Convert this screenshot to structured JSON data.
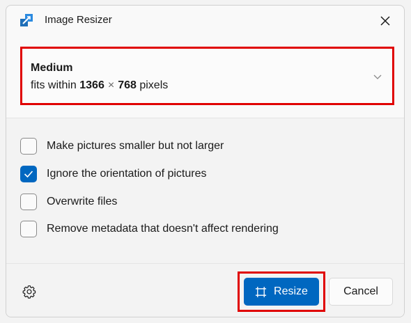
{
  "window": {
    "title": "Image Resizer",
    "app_icon": "image-resizer-app-icon",
    "close_icon": "close-icon"
  },
  "size": {
    "name": "Medium",
    "prefix": "fits within",
    "width": "1366",
    "times": "×",
    "height": "768",
    "unit": "pixels",
    "dropdown_icon": "chevron-down-icon"
  },
  "options": [
    {
      "label": "Make pictures smaller but not larger",
      "checked": false
    },
    {
      "label": "Ignore the orientation of pictures",
      "checked": true
    },
    {
      "label": "Overwrite files",
      "checked": false
    },
    {
      "label": "Remove metadata that doesn't affect rendering",
      "checked": false
    }
  ],
  "footer": {
    "settings_icon": "gear-icon",
    "resize_label": "Resize",
    "resize_icon": "resize-icon",
    "cancel_label": "Cancel"
  },
  "colors": {
    "accent": "#0067c0",
    "highlight": "#e00000"
  }
}
